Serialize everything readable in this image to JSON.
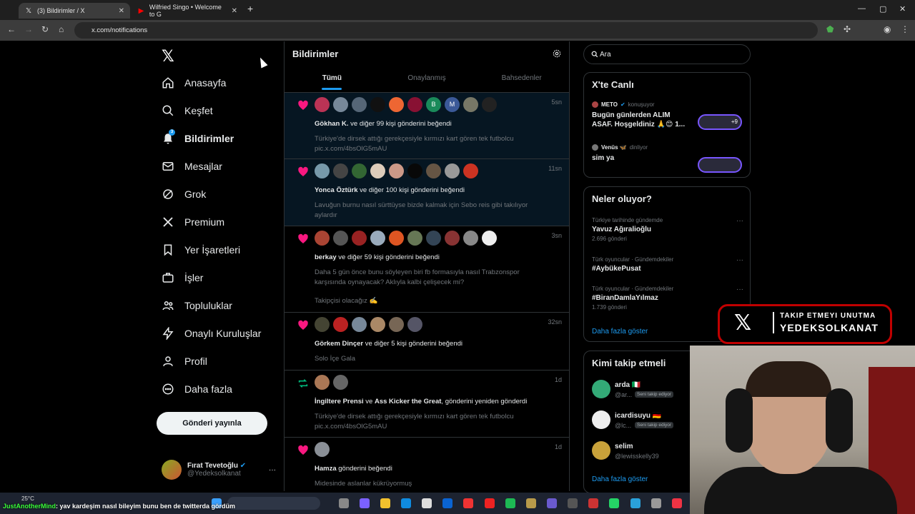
{
  "browser": {
    "tabs": [
      {
        "label": "(3) Bildirimler / X"
      },
      {
        "label": "Wilfried Singo • Welcome to G"
      }
    ],
    "address": "x.com/notifications"
  },
  "sidebar": {
    "items": [
      {
        "label": "Anasayfa"
      },
      {
        "label": "Keşfet"
      },
      {
        "label": "Bildirimler",
        "badge": "3"
      },
      {
        "label": "Mesajlar"
      },
      {
        "label": "Grok"
      },
      {
        "label": "Premium"
      },
      {
        "label": "Yer İşaretleri"
      },
      {
        "label": "İşler"
      },
      {
        "label": "Topluluklar"
      },
      {
        "label": "Onaylı Kuruluşlar"
      },
      {
        "label": "Profil"
      },
      {
        "label": "Daha fazla"
      }
    ],
    "post_label": "Gönderi yayınla",
    "account": {
      "name": "Fırat Tevetoğlu",
      "handle": "@Yedeksolkanat"
    }
  },
  "main": {
    "title": "Bildirimler",
    "tabs": [
      "Tümü",
      "Onaylanmış",
      "Bahsedenler"
    ],
    "notifications": [
      {
        "type": "like",
        "time": "5sn",
        "actor": "Gökhan K.",
        "rest": " ve diğer 99 kişi gönderini beğendi",
        "snippet": "Türkiye'de dirsek attığı gerekçesiyle kırmızı kart gören tek futbolcu pic.x.com/4bsOlG5mAU",
        "avatar_letters": [
          "",
          "",
          "",
          "",
          "",
          "",
          "B",
          "M",
          "",
          ""
        ]
      },
      {
        "type": "like",
        "time": "11sn",
        "actor": "Yonca Öztürk",
        "rest": " ve diğer 100 kişi gönderini beğendi",
        "snippet": "Lavuğun burnu nasıl sürttüyse bizde kalmak için Sebo reis gibi takılıyor aylardır"
      },
      {
        "type": "like",
        "time": "3sn",
        "actor": "berkay",
        "rest": " ve diğer 59 kişi gönderini beğendi",
        "snippet": "Daha 5 gün önce bunu söyleyen biri fb formasıyla nasıl Trabzonspor karşısında oynayacak? Aklıyla kalbi çelişecek mi?",
        "snippet2": "Takipçisi olacağız ✍️"
      },
      {
        "type": "like",
        "time": "32sn",
        "actor": "Görkem Dinçer",
        "rest": " ve diğer 5 kişi gönderini beğendi",
        "snippet": "Solo İçe Gala"
      },
      {
        "type": "repost",
        "time": "1d",
        "actor": "İngiltere Prensi",
        "mid": " ve ",
        "actor2": "Ass Kicker the Great",
        "rest": ", gönderini yeniden gönderdi",
        "snippet": "Türkiye'de dirsek attığı gerekçesiyle kırmızı kart gören tek futbolcu pic.x.com/4bsOlG5mAU"
      },
      {
        "type": "like",
        "time": "1d",
        "actor": "Hamza",
        "rest": " gönderini beğendi",
        "snippet": "Midesinde aslanlar kükrüyormuş"
      }
    ]
  },
  "right": {
    "search_placeholder": "Ara",
    "live": {
      "title": "X'te Canlı",
      "items": [
        {
          "host": "METO",
          "state": "konuşuyor",
          "body": "Bugün günlerden ALIM ASAF. Hoşgeldiniz 🙏😊 1...",
          "extra": "+9"
        },
        {
          "host": "Venüs 🦋",
          "state": "dinliyor",
          "body": "sim ya",
          "extra": ""
        }
      ]
    },
    "trends": {
      "title": "Neler oluyor?",
      "items": [
        {
          "context": "Türkiye tarihinde gündemde",
          "name": "Yavuz Ağıralioğlu",
          "count": "2.696 gönderi"
        },
        {
          "context": "Türk oyuncular · Gündemdekiler",
          "name": "#AybükePusat",
          "count": ""
        },
        {
          "context": "Türk oyuncular · Gündemdekiler",
          "name": "#BiranDamlaYılmaz",
          "count": "1.739 gönderi"
        }
      ],
      "show_more": "Daha fazla göster"
    },
    "who_to_follow": {
      "title": "Kimi takip etmeli",
      "items": [
        {
          "name": "arda 🇮🇹",
          "handle": "@ar...",
          "badge": "Seni takip ediyor"
        },
        {
          "name": "icardisuyu 🇩🇪",
          "handle": "@lc...",
          "badge": "Seni takip ediyor"
        },
        {
          "name": "selim",
          "handle": "@lewisskelly39",
          "badge": ""
        }
      ],
      "show_more": "Daha fazla göster"
    }
  },
  "overlay": {
    "line1": "TAKIP ETMEYI UNUTMA",
    "line2": "YEDEKSOLKANAT"
  },
  "taskbar": {
    "weather": "25°C",
    "chat_user": "JustAnotherMind",
    "chat_text": ": yav kardeşim nasıl bileyim bunu ben de twitterda gördüm"
  },
  "colors": {
    "accent": "#1d9bf0",
    "like": "#f91880",
    "repost": "#00ba7c"
  }
}
